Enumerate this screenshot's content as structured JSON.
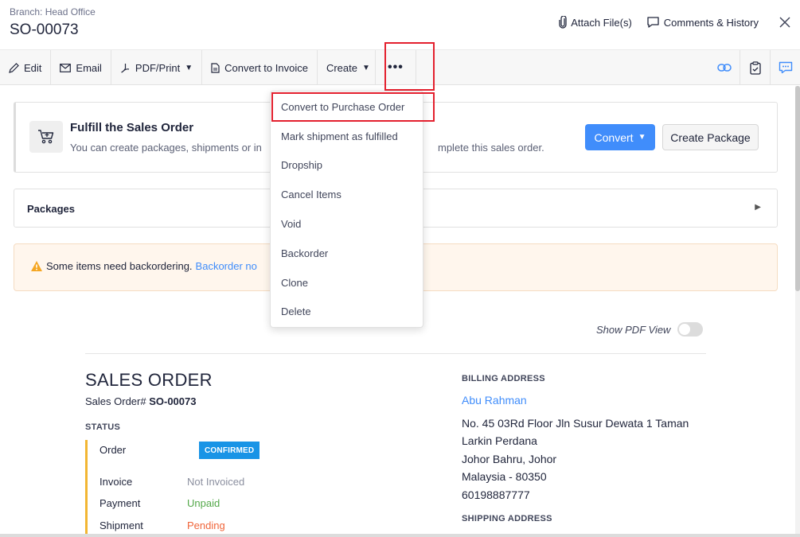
{
  "header": {
    "branch": "Branch: Head Office",
    "title": "SO-00073",
    "attach_label": "Attach File(s)",
    "comments_label": "Comments & History"
  },
  "toolbar": {
    "edit": "Edit",
    "email": "Email",
    "pdf_print": "PDF/Print",
    "convert_invoice": "Convert to Invoice",
    "create": "Create",
    "more": "•••"
  },
  "fulfill": {
    "title": "Fulfill the Sales Order",
    "desc_start": "You can create packages, shipments or in",
    "desc_end": "mplete this sales order.",
    "convert_label": "Convert",
    "create_package_label": "Create Package"
  },
  "packages": {
    "title": "Packages"
  },
  "warning": {
    "text": "Some items need backordering.",
    "link": "Backorder no"
  },
  "pdf_view": {
    "label": "Show PDF View",
    "enabled": false
  },
  "document": {
    "title": "SALES ORDER",
    "number_label": "Sales Order#",
    "number": "SO-00073",
    "status_heading": "STATUS",
    "status": [
      {
        "key": "Order",
        "value": "CONFIRMED"
      },
      {
        "key": "Invoice",
        "value": "Not Invoiced",
        "color": "#8b8f9f"
      },
      {
        "key": "Payment",
        "value": "Unpaid",
        "color": "#53a849"
      },
      {
        "key": "Shipment",
        "value": "Pending",
        "color": "#f0653a"
      }
    ],
    "badge_color": "#1994e6"
  },
  "billing": {
    "heading": "BILLING ADDRESS",
    "name": "Abu Rahman",
    "lines": [
      "No. 45 03Rd Floor Jln Susur Dewata 1 Taman",
      "Larkin Perdana",
      "Johor Bahru, Johor",
      "Malaysia - 80350",
      "60198887777"
    ]
  },
  "shipping": {
    "heading": "SHIPPING ADDRESS"
  },
  "dropdown": {
    "items": [
      "Convert to Purchase Order",
      "Mark shipment as fulfilled",
      "Dropship",
      "Cancel Items",
      "Void",
      "Backorder",
      "Clone",
      "Delete"
    ]
  },
  "colors": {
    "accent": "#408dfb",
    "highlight": "#e3202e",
    "status_bar": "#f2b633"
  }
}
